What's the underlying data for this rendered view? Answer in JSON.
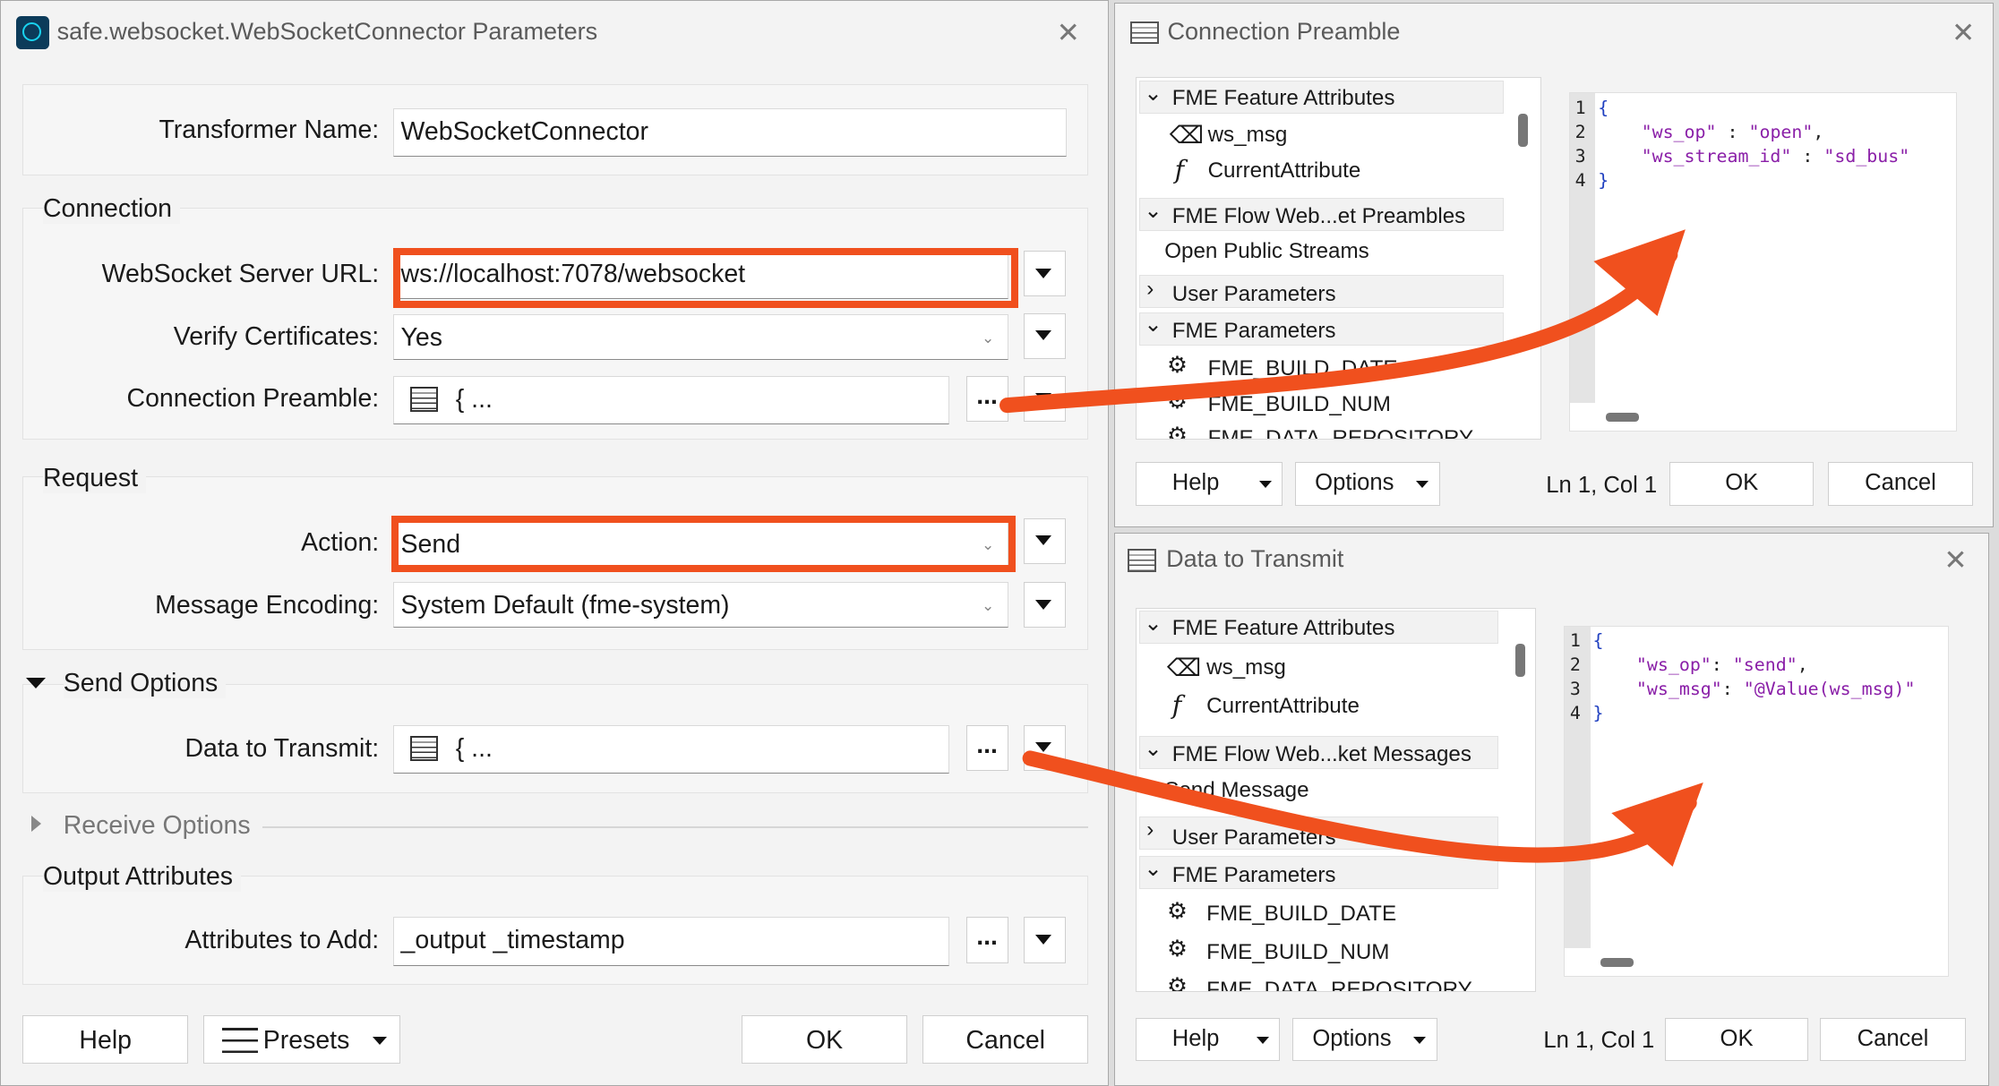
{
  "main": {
    "title": "safe.websocket.WebSocketConnector Parameters",
    "transformer_name_label": "Transformer Name:",
    "transformer_name_value": "WebSocketConnector",
    "connection_header": "Connection",
    "server_url_label": "WebSocket Server URL:",
    "server_url_value": "ws://localhost:7078/websocket",
    "verify_label": "Verify Certificates:",
    "verify_value": "Yes",
    "preamble_label": "Connection Preamble:",
    "preamble_value": "{ ...",
    "request_header": "Request",
    "action_label": "Action:",
    "action_value": "Send",
    "encoding_label": "Message Encoding:",
    "encoding_value": "System Default (fme-system)",
    "send_options_header": "Send Options",
    "data_label": "Data to Transmit:",
    "data_value": "{ ...",
    "receive_options_header": "Receive Options",
    "output_header": "Output Attributes",
    "attrs_label": "Attributes to Add:",
    "attrs_value": "_output _timestamp",
    "dots": "...",
    "help": "Help",
    "presets": "Presets",
    "ok": "OK",
    "cancel": "Cancel"
  },
  "preamble_dialog": {
    "title": "Connection Preamble",
    "tree": {
      "feature_attrs": "FME Feature Attributes",
      "ws_msg": "ws_msg",
      "current_attr": "CurrentAttribute",
      "flow_group": "FME Flow Web...et Preambles",
      "flow_item": "Open Public Streams",
      "user_params": "User Parameters",
      "fme_params": "FME Parameters",
      "build_date": "FME_BUILD_DATE",
      "build_num": "FME_BUILD_NUM",
      "data_repo": "FME_DATA_REPOSITORY"
    },
    "code": {
      "line1": "{",
      "line2_key": "\"ws_op\"",
      "line2_sep": " : ",
      "line2_val": "\"open\"",
      "line2_end": ",",
      "line3_key": "\"ws_stream_id\"",
      "line3_sep": " : ",
      "line3_val": "\"sd_bus\"",
      "line4": "}"
    },
    "help": "Help",
    "options": "Options",
    "position": "Ln 1, Col 1",
    "ok": "OK",
    "cancel": "Cancel"
  },
  "data_dialog": {
    "title": "Data to Transmit",
    "tree": {
      "feature_attrs": "FME Feature Attributes",
      "ws_msg": "ws_msg",
      "current_attr": "CurrentAttribute",
      "flow_group": "FME Flow Web...ket Messages",
      "flow_item": "Send Message",
      "user_params": "User Parameters",
      "fme_params": "FME Parameters",
      "build_date": "FME_BUILD_DATE",
      "build_num": "FME_BUILD_NUM",
      "data_repo": "FME_DATA_REPOSITORY"
    },
    "code": {
      "line1": "{",
      "line2_key": "\"ws_op\"",
      "line2_sep": ": ",
      "line2_val": "\"send\"",
      "line2_end": ",",
      "line3_key": "\"ws_msg\"",
      "line3_sep": ": ",
      "line3_val": "\"@Value(ws_msg)\"",
      "line4": "}"
    },
    "help": "Help",
    "options": "Options",
    "position": "Ln 1, Col 1",
    "ok": "OK",
    "cancel": "Cancel"
  },
  "colors": {
    "annotation_red": "#f0501e",
    "json_string": "#8a1fa8",
    "json_brace": "#2040c0"
  },
  "icons": [
    "app-logo-icon",
    "close-icon",
    "text-editor-icon",
    "chevron-down-icon",
    "chevron-right-icon",
    "attribute-icon",
    "function-icon",
    "parameter-icon",
    "presets-icon",
    "annotation-arrow"
  ]
}
